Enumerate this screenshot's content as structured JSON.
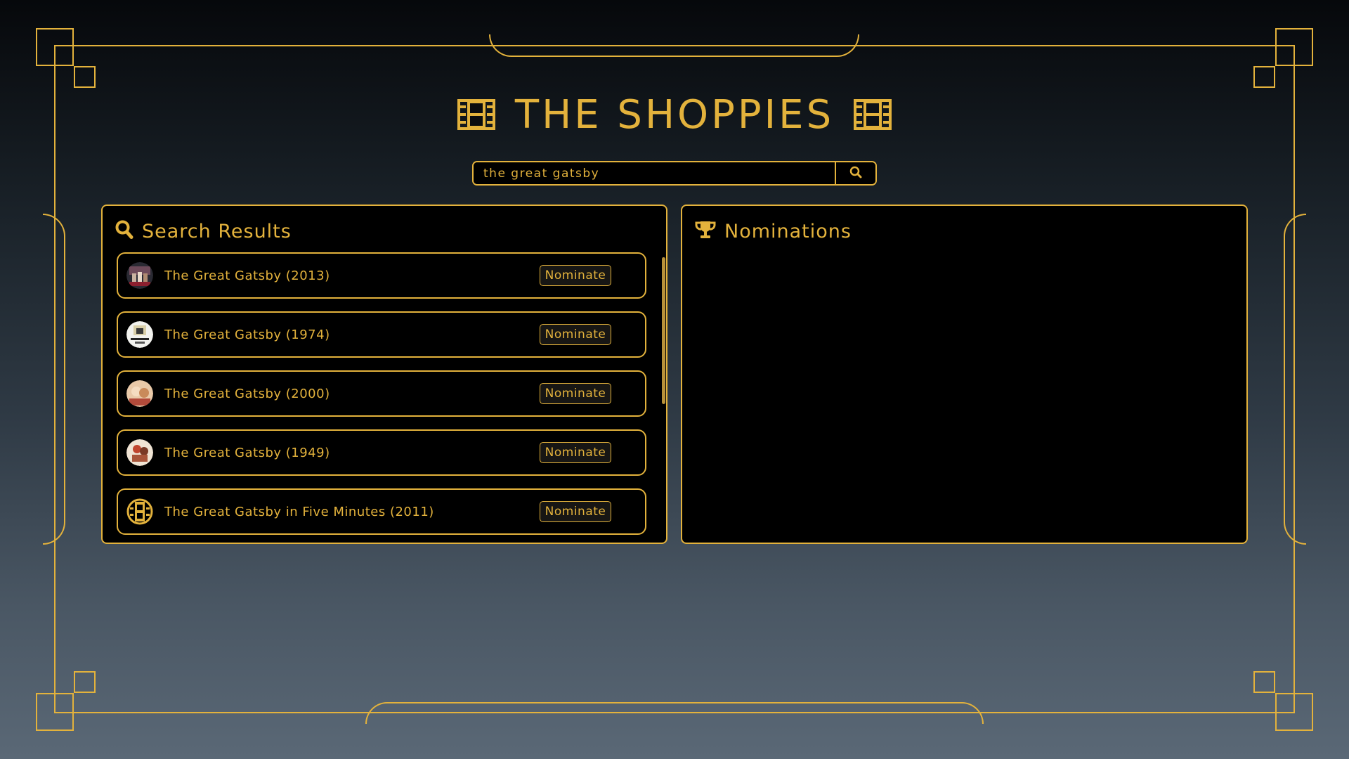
{
  "app": {
    "title": "THE SHOPPIES"
  },
  "search": {
    "value": "the great gatsby",
    "icon": "search-icon"
  },
  "results_panel": {
    "title": "Search Results",
    "icon": "search-icon",
    "items": [
      {
        "label": "The Great Gatsby (2013)",
        "button": "Nominate",
        "poster": "poster-2013"
      },
      {
        "label": "The Great Gatsby (1974)",
        "button": "Nominate",
        "poster": "poster-1974"
      },
      {
        "label": "The Great Gatsby (2000)",
        "button": "Nominate",
        "poster": "poster-2000"
      },
      {
        "label": "The Great Gatsby (1949)",
        "button": "Nominate",
        "poster": "poster-1949"
      },
      {
        "label": "The Great Gatsby in Five Minutes (2011)",
        "button": "Nominate",
        "poster": "film-icon"
      }
    ]
  },
  "nominations_panel": {
    "title": "Nominations",
    "icon": "trophy-icon",
    "items": []
  },
  "colors": {
    "accent": "#e3b23c",
    "panel_bg": "#000000"
  }
}
